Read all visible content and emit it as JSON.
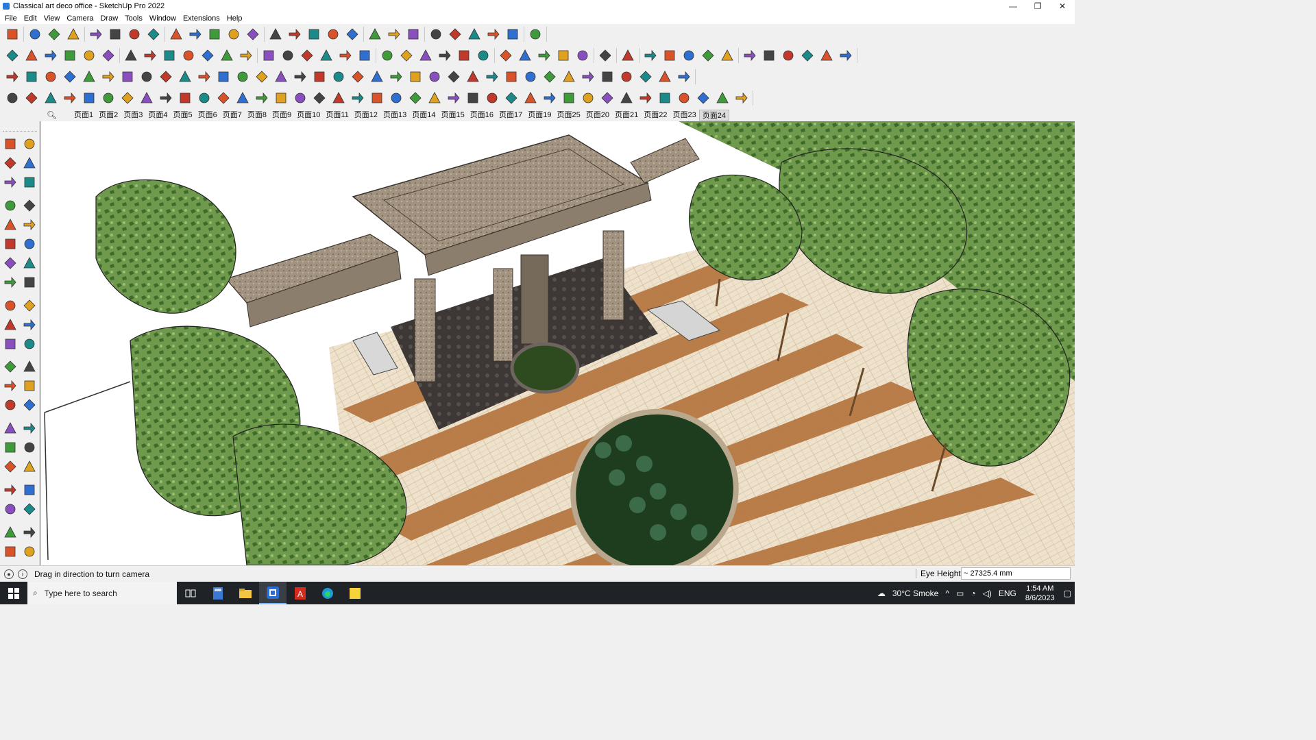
{
  "window": {
    "title": "Classical art deco office - SketchUp Pro 2022",
    "minimize": "—",
    "maximize": "❐",
    "close": "✕"
  },
  "menu": [
    "File",
    "Edit",
    "View",
    "Camera",
    "Draw",
    "Tools",
    "Window",
    "Extensions",
    "Help"
  ],
  "scenes": {
    "tabs": [
      "页面1",
      "页面2",
      "页面3",
      "页面4",
      "页面5",
      "页面6",
      "页面7",
      "页面8",
      "页面9",
      "页面10",
      "页面11",
      "页面12",
      "页面13",
      "页面14",
      "页面15",
      "页面16",
      "页面17",
      "页面19",
      "页面25",
      "页面20",
      "页面21",
      "页面22",
      "页面23",
      "页面24"
    ],
    "active": "页面24"
  },
  "status": {
    "message": "Drag in direction to turn camera",
    "vcb_label": "Eye Height",
    "vcb_value": "~ 27325.4 mm"
  },
  "taskbar": {
    "search_placeholder": "Type here to search",
    "weather": "30°C  Smoke",
    "language": "ENG",
    "time": "1:54 AM",
    "date": "8/6/2023"
  },
  "colors": {
    "titlebar_bg": "#ffffff",
    "chrome_bg": "#f0f0f0",
    "taskbar_bg": "#1f2226",
    "paving_light": "#efe2cc",
    "paving_brown": "#b5753f",
    "tree_green": "#6f9a4d",
    "stone": "#a29380"
  }
}
